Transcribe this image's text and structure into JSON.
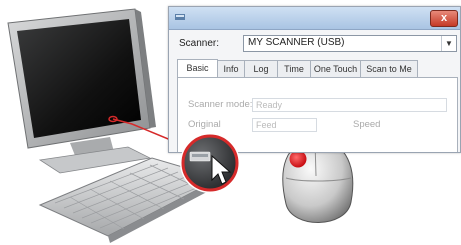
{
  "dialog": {
    "title": "",
    "close_glyph": "x",
    "scanner_label": "Scanner:",
    "scanner_value": "MY SCANNER (USB)",
    "tabs": [
      "Basic",
      "Info",
      "Log",
      "Time",
      "One Touch",
      "Scan to Me"
    ],
    "status_label": "Scanner mode:",
    "status_value": "Ready",
    "original_label": "Original",
    "original_value": "Feed",
    "speed_label": "Speed"
  },
  "icons": [
    "scanner-app-icon",
    "close-icon",
    "dropdown-arrow-icon",
    "mouse-pointer-icon",
    "scanner-icon"
  ],
  "colors": {
    "callout_ring": "#d62a2a",
    "mouse_button_highlight": "#e4161b",
    "titlebar": "#a9c4e3"
  }
}
